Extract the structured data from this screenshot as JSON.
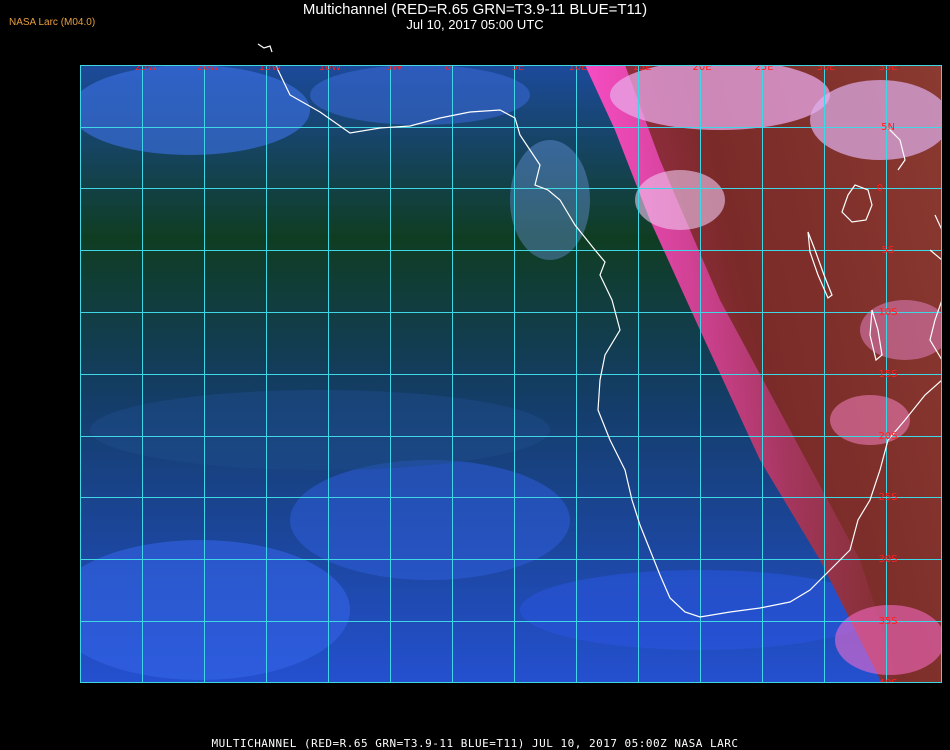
{
  "header": {
    "title_line_1": "Multichannel (RED=R.65 GRN=T3.9-11 BLUE=T11)",
    "title_line_2": "Jul 10, 2017 05:00 UTC",
    "provider_tag": "NASA Larc (M04.0)"
  },
  "footer": {
    "caption": "MULTICHANNEL (RED=R.65 GRN=T3.9-11 BLUE=T11) JUL 10, 2017 05:00Z   NASA LARC"
  },
  "map": {
    "longitude_labels": [
      "25W",
      "20W",
      "15W",
      "10W",
      "5W",
      "0",
      "5E",
      "10E",
      "15E",
      "20E",
      "25E",
      "30E",
      "35E"
    ],
    "latitude_labels": [
      "5N",
      "0",
      "5S",
      "10S",
      "15S",
      "20S",
      "25S",
      "30S",
      "35S",
      "40S"
    ],
    "colors": {
      "ocean_dark": "#0c3a1c",
      "ocean_blue": "#1f4fc8",
      "land_red": "#8a2a20",
      "limb_pink": "#ff50c8",
      "cloud": "#c8a0e8",
      "grid": "#3fd6e6",
      "coastline": "#ffffff",
      "label": "#ff2020"
    }
  }
}
